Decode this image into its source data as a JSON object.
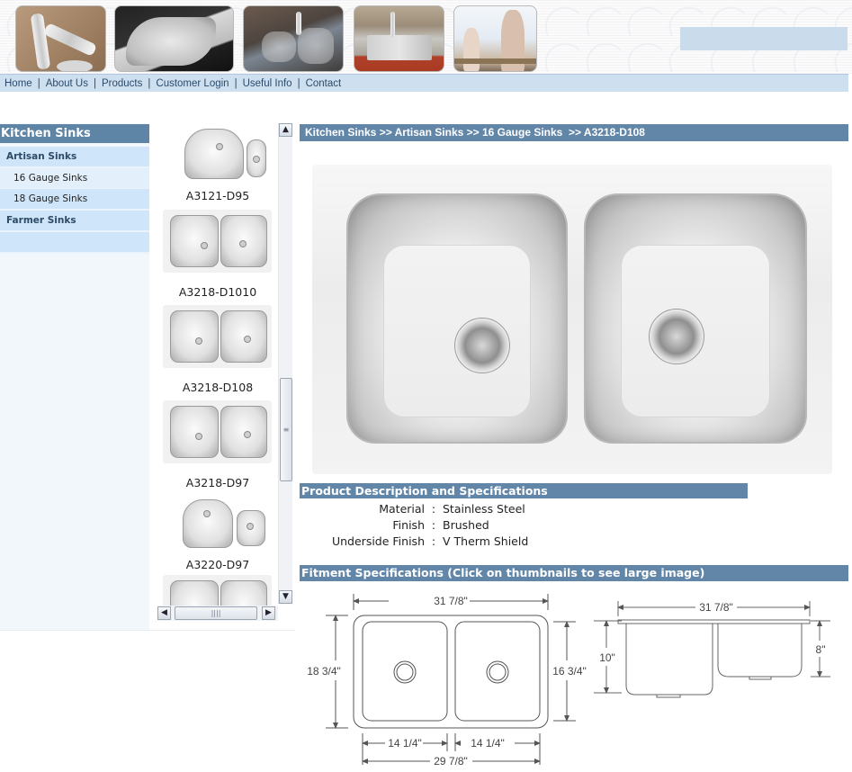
{
  "header": {
    "banner_images": [
      {
        "name": "pull-out-faucet"
      },
      {
        "name": "undermount-sink-granite"
      },
      {
        "name": "double-bowl-sink"
      },
      {
        "name": "farmer-sink"
      },
      {
        "name": "kitchen-couple"
      }
    ]
  },
  "nav": {
    "items": [
      {
        "label": "Home"
      },
      {
        "label": "About Us"
      },
      {
        "label": "Products"
      },
      {
        "label": "Customer Login"
      },
      {
        "label": "Useful Info"
      },
      {
        "label": "Contact"
      }
    ],
    "separator": "|"
  },
  "sidebar": {
    "title": "Kitchen Sinks",
    "items": [
      {
        "label": "Artisan Sinks",
        "type": "category"
      },
      {
        "label": "16 Gauge Sinks",
        "type": "subcategory",
        "selected": true
      },
      {
        "label": "18 Gauge Sinks",
        "type": "subcategory"
      },
      {
        "label": "Farmer Sinks",
        "type": "category"
      }
    ]
  },
  "thumbnails": [
    {
      "label": "A3121-D95"
    },
    {
      "label": "A3218-D1010"
    },
    {
      "label": "A3218-D108"
    },
    {
      "label": "A3218-D97"
    },
    {
      "label": "A3220-D97"
    }
  ],
  "scrollbar": {
    "up_icon": "▲",
    "down_icon": "▼",
    "left_icon": "◀",
    "right_icon": "▶",
    "grip": "≡",
    "hgrip": "||||"
  },
  "breadcrumb": "Kitchen Sinks >> Artisan Sinks >> 16 Gauge Sinks  >> A3218-D108",
  "product": {
    "model": "A3218-D108",
    "description_title": "Product Description and Specifications",
    "specs": [
      {
        "label": "Material",
        "value": "Stainless Steel"
      },
      {
        "label": "Finish",
        "value": "Brushed"
      },
      {
        "label": "Underside Finish",
        "value": "V Therm Shield"
      }
    ],
    "spec_separator": ":"
  },
  "fitment": {
    "title": "Fitment Specifications (Click on thumbnails to see large image)",
    "top_view": {
      "overall_width": "31 7/8\"",
      "overall_depth": "18 3/4\"",
      "bowl_depth": "16 3/4\"",
      "left_bowl_width": "14 1/4\"",
      "right_bowl_width": "14 1/4\"",
      "inner_width": "29 7/8\""
    },
    "side_view": {
      "overall_width": "31 7/8\"",
      "left_height": "10\"",
      "right_height": "8\""
    }
  }
}
